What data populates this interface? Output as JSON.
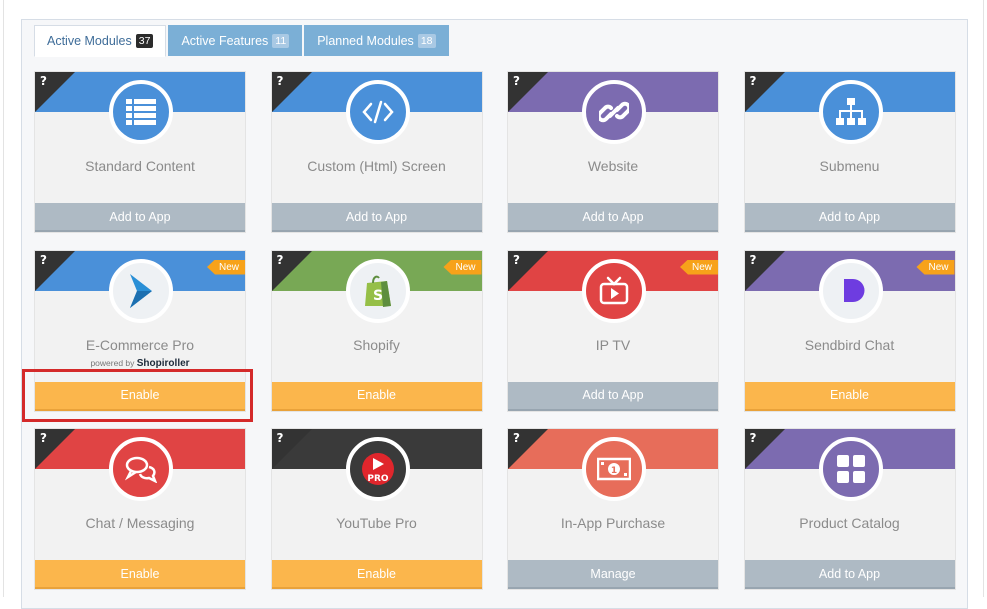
{
  "tabs": [
    {
      "label": "Active Modules",
      "count": "37",
      "active": true
    },
    {
      "label": "Active Features",
      "count": "11",
      "active": false
    },
    {
      "label": "Planned Modules",
      "count": "18",
      "active": false
    }
  ],
  "help_mark": "?",
  "new_label": "New",
  "powered_by": {
    "prefix": "powered by",
    "brand": "Shopiroller"
  },
  "colors": {
    "blue": "#4a90d9",
    "purple": "#7c6bb0",
    "green": "#78a855",
    "red": "#e04444",
    "dark": "#3a3a3a",
    "salmon": "#e76d5a",
    "orange_button": "#fbb64c",
    "gray_button": "#aebac4"
  },
  "modules": [
    {
      "title": "Standard Content",
      "icon": "list-icon",
      "color": "#4a90d9",
      "button": "Add to App",
      "button_style": "gray",
      "new": false
    },
    {
      "title": "Custom (Html) Screen",
      "icon": "code-icon",
      "color": "#4a90d9",
      "button": "Add to App",
      "button_style": "gray",
      "new": false
    },
    {
      "title": "Website",
      "icon": "link-icon",
      "color": "#7c6bb0",
      "button": "Add to App",
      "button_style": "gray",
      "new": false
    },
    {
      "title": "Submenu",
      "icon": "sitemap-icon",
      "color": "#4a90d9",
      "button": "Add to App",
      "button_style": "gray",
      "new": false
    },
    {
      "title": "E-Commerce Pro",
      "icon": "shopiroller-logo-icon",
      "color": "#4a90d9",
      "button": "Enable",
      "button_style": "orange",
      "new": true
    },
    {
      "title": "Shopify",
      "icon": "shopify-bag-icon",
      "color": "#78a855",
      "button": "Enable",
      "button_style": "orange",
      "new": true
    },
    {
      "title": "IP TV",
      "icon": "tv-icon",
      "color": "#e04444",
      "button": "Add to App",
      "button_style": "gray",
      "new": true
    },
    {
      "title": "Sendbird Chat",
      "icon": "sendbird-logo-icon",
      "color": "#7c6bb0",
      "button": "Enable",
      "button_style": "orange",
      "new": true
    },
    {
      "title": "Chat / Messaging",
      "icon": "chat-bubbles-icon",
      "color": "#e04444",
      "button": "Enable",
      "button_style": "orange",
      "new": false
    },
    {
      "title": "YouTube Pro",
      "icon": "youtube-pro-icon",
      "color": "#3a3a3a",
      "button": "Enable",
      "button_style": "orange",
      "new": false
    },
    {
      "title": "In-App Purchase",
      "icon": "money-icon",
      "color": "#e76d5a",
      "button": "Manage",
      "button_style": "gray",
      "new": false
    },
    {
      "title": "Product Catalog",
      "icon": "grid-icon",
      "color": "#7c6bb0",
      "button": "Add to App",
      "button_style": "gray",
      "new": false
    }
  ]
}
